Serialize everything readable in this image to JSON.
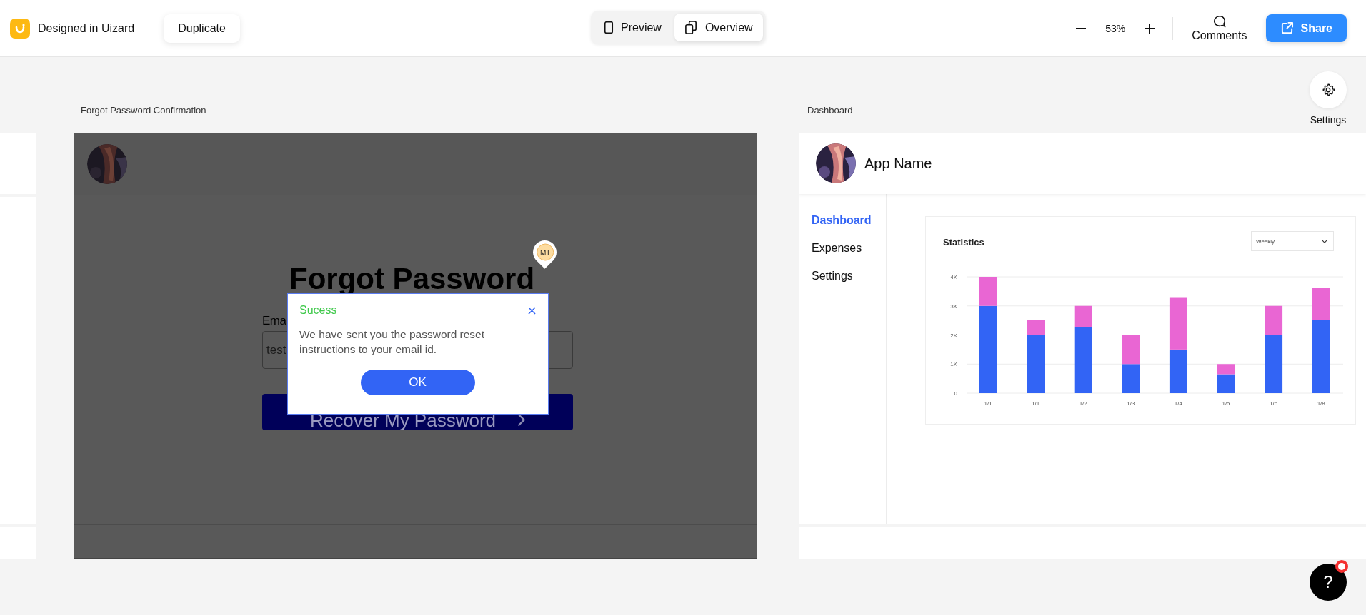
{
  "toolbar": {
    "brand": "Designed in Uizard",
    "duplicate": "Duplicate",
    "view_modes": [
      {
        "label": "Preview",
        "kind": "phone",
        "selected": false
      },
      {
        "label": "Overview",
        "kind": "pages",
        "selected": true
      }
    ],
    "zoom": "53%",
    "comments": "Comments",
    "share": "Share"
  },
  "settings_button": {
    "label": "Settings"
  },
  "forgot_frame": {
    "title": "Forgot Password Confirmation",
    "heading": "Forgot Password",
    "email_label": "Ema",
    "email_value": "test",
    "button": "Recover My Password",
    "cursor_badge": "MT",
    "dialog": {
      "title": "Sucess",
      "message": "We have sent you the password reset instructions to your email id.",
      "ok": "OK"
    }
  },
  "dashboard_frame": {
    "title": "Dashboard",
    "app_name": "App Name",
    "nav": [
      {
        "label": "Dashboard",
        "selected": true
      },
      {
        "label": "Expenses",
        "selected": false
      },
      {
        "label": "Settings",
        "selected": false
      }
    ],
    "card": {
      "title": "Statistics",
      "dropdown": "Weekly",
      "chart_data": {
        "type": "bar",
        "stacked": true,
        "grid": true,
        "categories": [
          "1/1",
          "1/1",
          "1/2",
          "1/3",
          "1/4",
          "1/5",
          "1/6",
          "1/8"
        ],
        "ylim": [
          0,
          4000
        ],
        "yticks": [
          {
            "value": 0,
            "label": "0"
          },
          {
            "value": 1000,
            "label": "1K"
          },
          {
            "value": 2000,
            "label": "2K"
          },
          {
            "value": 3000,
            "label": "3K"
          },
          {
            "value": 4000,
            "label": "4K"
          }
        ],
        "series": [
          {
            "color": "#3264f5",
            "values": [
              3000,
              2000,
              2280,
              1000,
              1500,
              650,
              2000,
              2520
            ]
          },
          {
            "color": "#e966d3",
            "values": [
              1000,
              520,
              720,
              1000,
              1800,
              350,
              1000,
              1100
            ]
          }
        ]
      }
    }
  },
  "help_button": {
    "label": "?",
    "has_notification": true
  }
}
